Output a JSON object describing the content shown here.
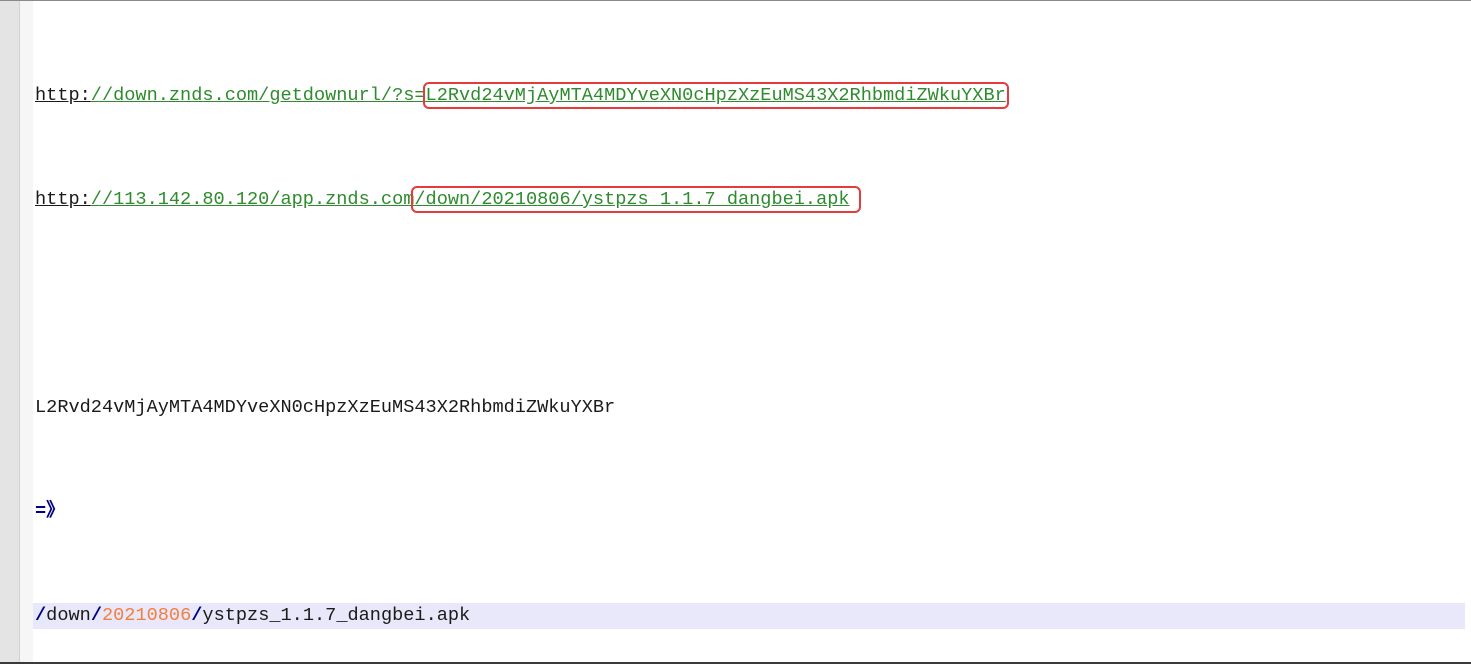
{
  "lines": [
    {
      "scheme": "http:",
      "rest": "//down.znds.com/getdownurl/?s=",
      "boxed": "L2Rvd24vMjAyMTA4MDYveXN0cHpzXzEuMS43X2RhbmdiZWkuYXBr"
    },
    {
      "scheme": "http:",
      "rest": "//113.142.80.120/app.znds.com",
      "boxed": "/down/20210806/ystpzs_1.1.7_dangbei.apk"
    },
    {
      "text": ""
    },
    {
      "text": "L2Rvd24vMjAyMTA4MDYveXN0cHpzXzEuMS43X2RhbmdiZWkuYXBr"
    },
    {
      "arrow": "=》"
    },
    {
      "slash1": "/",
      "seg1": "down",
      "slash2": "/",
      "date": "20210806",
      "slash3": "/",
      "file": "ystpzs_1.1.7_dangbei.apk"
    }
  ],
  "colors": {
    "url_green": "#2e8b2e",
    "highlight_box": "#e53b3b",
    "number_orange": "#f08040",
    "operator_navy": "#000080",
    "current_line": "#e8e8fa"
  }
}
